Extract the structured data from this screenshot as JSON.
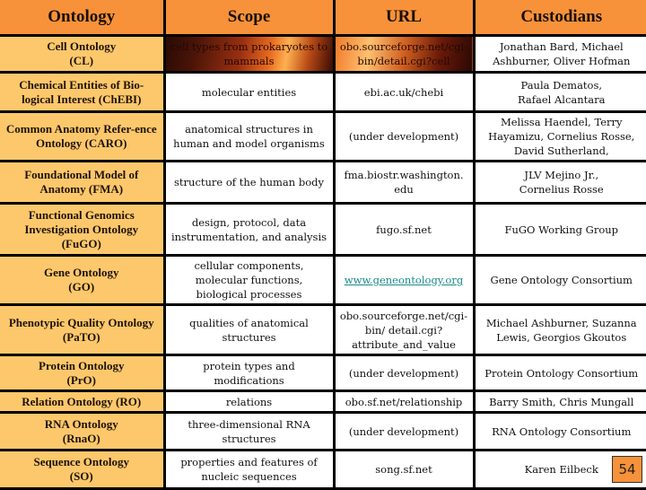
{
  "header": {
    "ontology": "Ontology",
    "scope": "Scope",
    "url": "URL",
    "custodians": "Custodians"
  },
  "rows": [
    {
      "ontology": "Cell Ontology\n(CL)",
      "scope": "cell types from prokaryotes to mammals",
      "url": "obo.sourceforge.net/cgi-bin/detail.cgi?cell",
      "custodians": "Jonathan Bard, Michael Ashburner, Oliver Hofman"
    },
    {
      "ontology": "Chemical Entities of Bio-logical Interest (ChEBI)",
      "scope": "molecular entities",
      "url": "ebi.ac.uk/chebi",
      "custodians": "Paula Dematos,\nRafael Alcantara"
    },
    {
      "ontology": "Common Anatomy Refer-ence Ontology (CARO)",
      "scope": "anatomical structures in human and model organisms",
      "url": "(under development)",
      "custodians": "Melissa Haendel, Terry Hayamizu, Cornelius Rosse, David Sutherland,"
    },
    {
      "ontology": "Foundational Model of Anatomy (FMA)",
      "scope": "structure of the human body",
      "url": "fma.biostr.washington.\nedu",
      "custodians": "JLV Mejino Jr.,\nCornelius Rosse"
    },
    {
      "ontology": "Functional Genomics Investigation Ontology (FuGO)",
      "scope": "design, protocol, data instrumentation, and analysis",
      "url": "fugo.sf.net",
      "custodians": "FuGO Working Group"
    },
    {
      "ontology": "Gene Ontology\n(GO)",
      "scope": "cellular components, molecular functions, biological processes",
      "url": "www.geneontology.org",
      "custodians": "Gene Ontology Consortium"
    },
    {
      "ontology": "Phenotypic Quality Ontology\n(PaTO)",
      "scope": "qualities of anatomical structures",
      "url": "obo.sourceforge.net/cgi-bin/ detail.cgi? attribute_and_value",
      "custodians": "Michael Ashburner, Suzanna Lewis, Georgios Gkoutos"
    },
    {
      "ontology": "Protein Ontology\n(PrO)",
      "scope": "protein types and modifications",
      "url": "(under development)",
      "custodians": "Protein Ontology Consortium"
    },
    {
      "ontology": "Relation Ontology (RO)",
      "scope": "relations",
      "url": "obo.sf.net/relationship",
      "custodians": "Barry Smith, Chris Mungall"
    },
    {
      "ontology": "RNA Ontology\n(RnaO)",
      "scope": "three-dimensional RNA structures",
      "url": "(under development)",
      "custodians": "RNA Ontology Consortium"
    },
    {
      "ontology": "Sequence Ontology\n(SO)",
      "scope": "properties and features of nucleic sequences",
      "url": "song.sf.net",
      "custodians": "Karen Eilbeck"
    }
  ],
  "page_number": "54",
  "colors": {
    "header_bg": "#f7923a",
    "ontology_col_bg": "#fdc86b",
    "link": "#1a8a8a"
  }
}
